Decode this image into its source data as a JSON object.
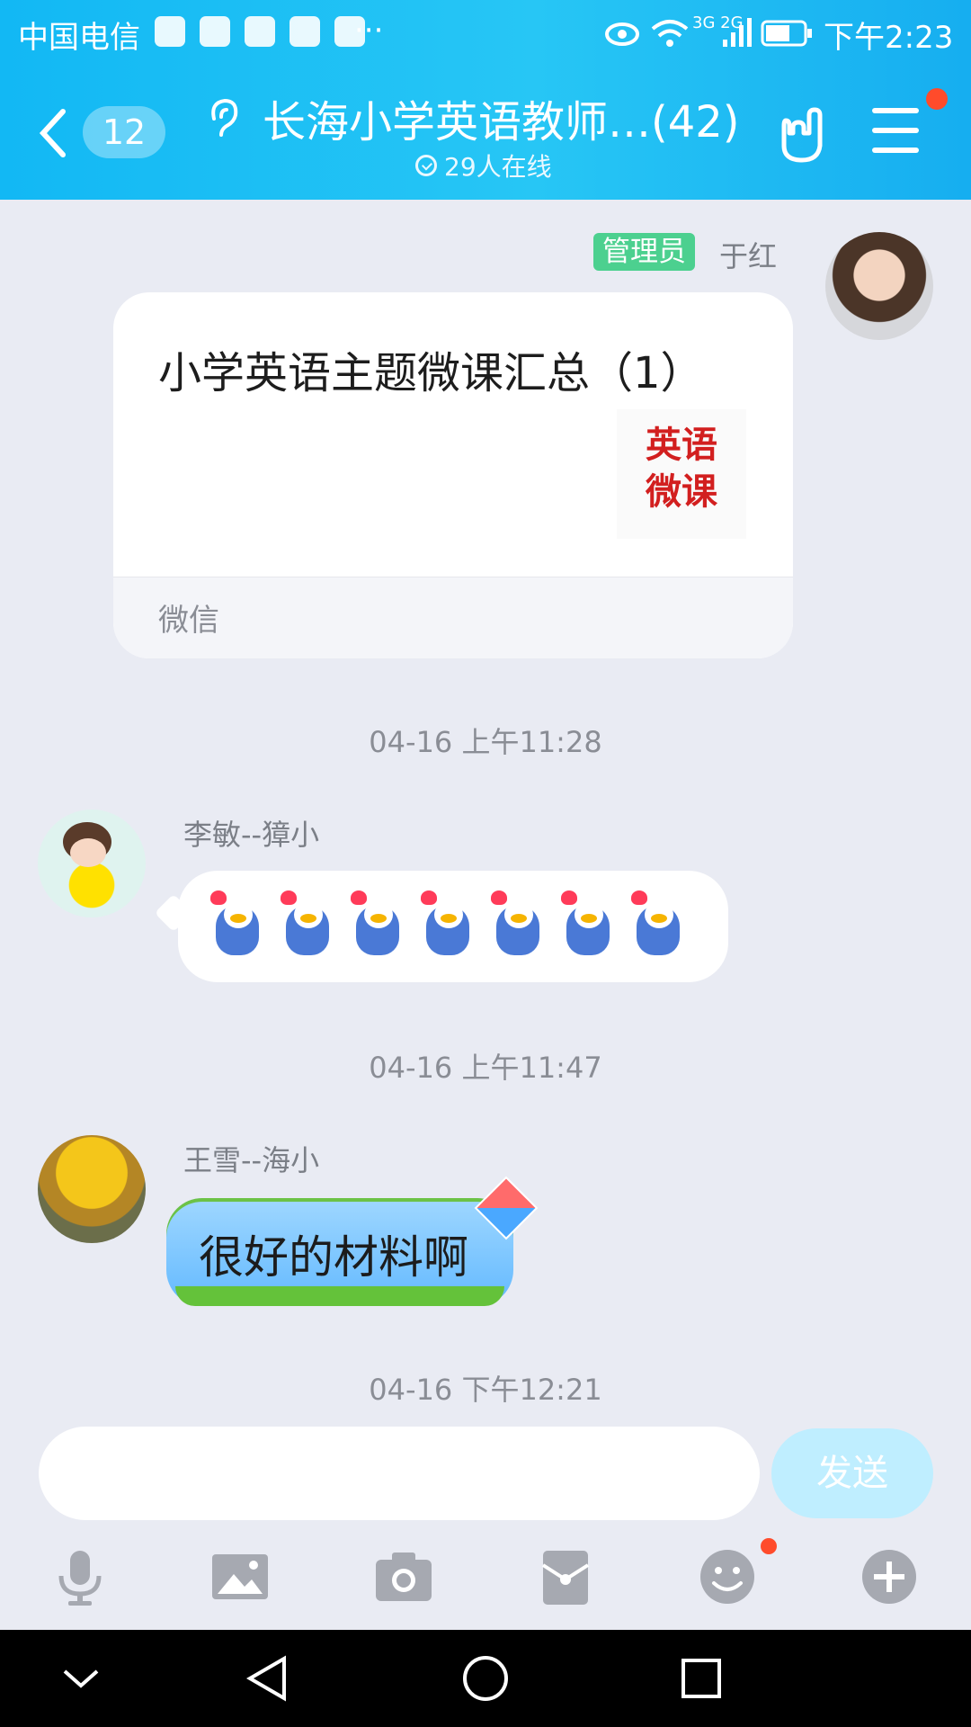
{
  "status_bar": {
    "carrier": "中国电信",
    "overflow": "···",
    "network": "3G 2G",
    "time": "下午2:23"
  },
  "header": {
    "unread_count": "12",
    "group_title": "长海小学英语教师…(42)",
    "online_text": "29人在线"
  },
  "messages": [
    {
      "sender_role": "管理员",
      "sender_name": "于红",
      "card_title": "小学英语主题微课汇总（1）",
      "card_thumb_line1": "英语",
      "card_thumb_line2": "微课",
      "card_source": "微信"
    },
    {
      "timestamp": "04-16 上午11:28"
    },
    {
      "sender_name": "李敏--獐小",
      "emoji_count": 7
    },
    {
      "timestamp": "04-16 上午11:47"
    },
    {
      "sender_name": "王雪--海小",
      "text": "很好的材料啊"
    },
    {
      "timestamp": "04-16 下午12:21"
    }
  ],
  "input": {
    "placeholder": "",
    "send_label": "发送"
  },
  "toolbar_icons": [
    "microphone-icon",
    "image-icon",
    "camera-icon",
    "red-packet-icon",
    "emoji-icon",
    "plus-icon"
  ],
  "colors": {
    "header": "#20bdf4",
    "background": "#e9ebf3",
    "admin_tag": "#4cd08f",
    "notification_dot": "#ff4b2b"
  }
}
